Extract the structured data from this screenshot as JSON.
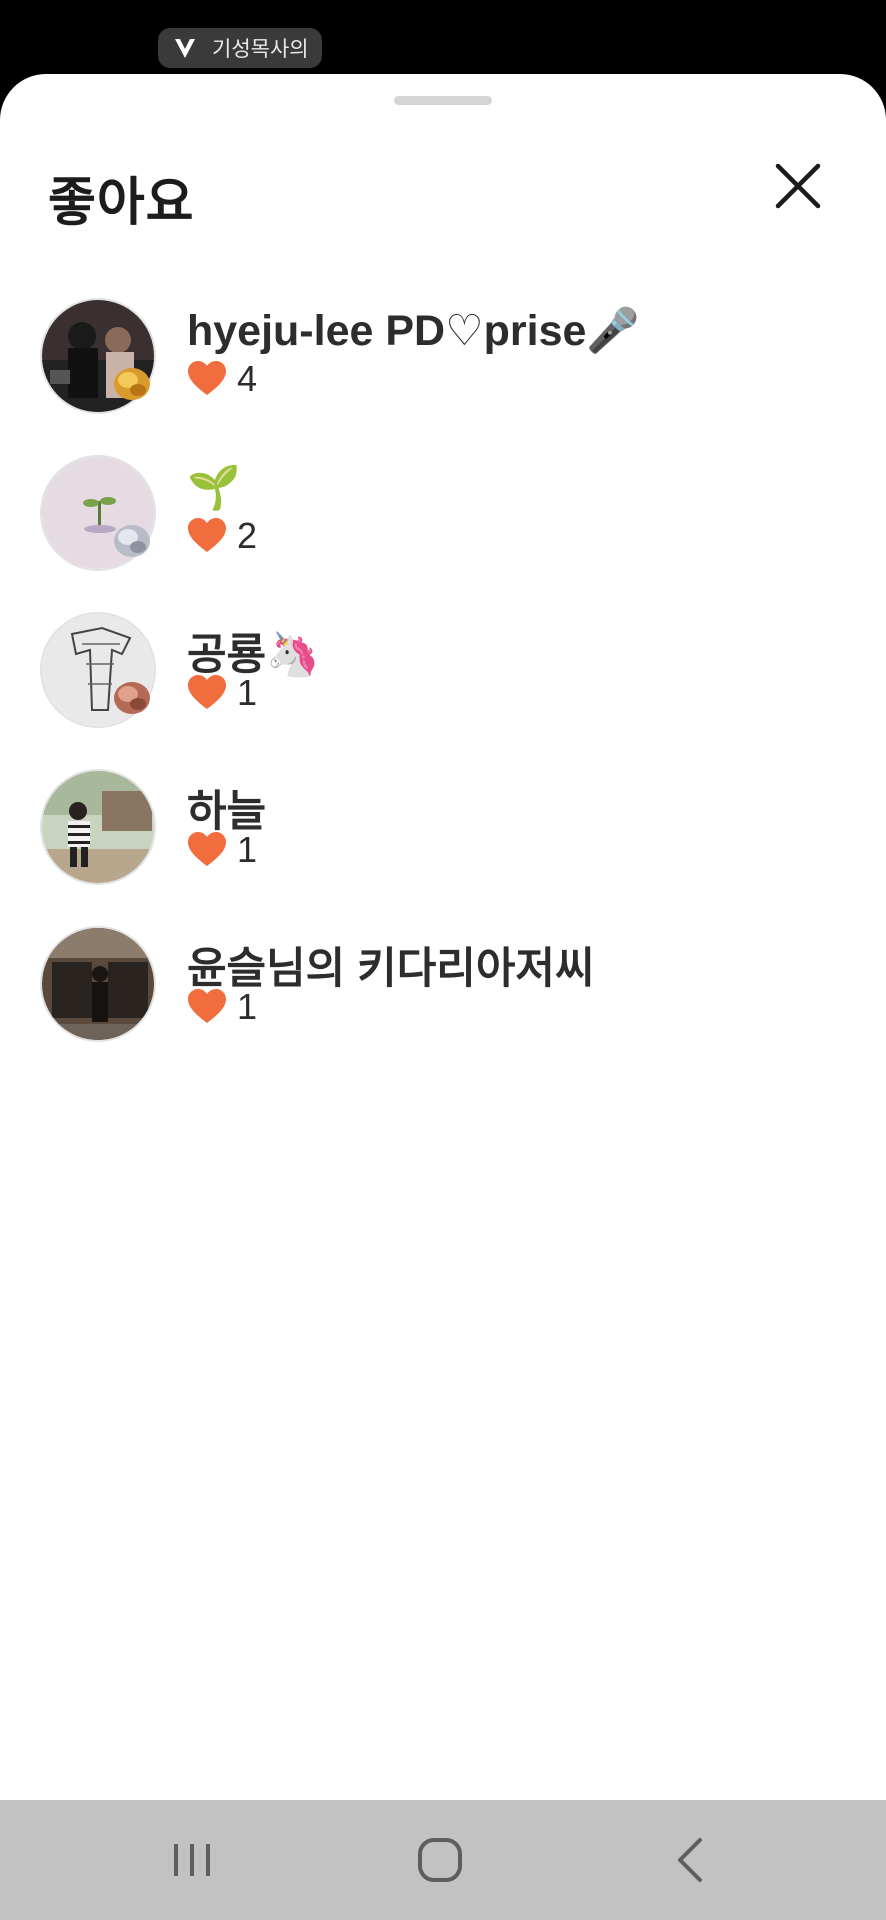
{
  "status_bar": {
    "notification_text": "기성목사의",
    "notification_icon": "v-logo-icon"
  },
  "sheet": {
    "title": "좋아요",
    "close_icon": "close-icon"
  },
  "likes": [
    {
      "name": "hyeju-lee PD♡prise🎤",
      "count": "4",
      "avatar": "photo-two-people",
      "badge": "gold-badge"
    },
    {
      "name": "🌱",
      "count": "2",
      "avatar": "photo-sprout",
      "badge": "silver-badge"
    },
    {
      "name": "공룡🦄",
      "count": "1",
      "avatar": "photo-sketch",
      "badge": "bronze-badge"
    },
    {
      "name": "하늘",
      "count": "1",
      "avatar": "photo-child-outdoors",
      "badge": ""
    },
    {
      "name": "윤슬님의 키다리아저씨",
      "count": "1",
      "avatar": "photo-storefront",
      "badge": ""
    }
  ],
  "heart_color": "#f26d3d",
  "nav_bar": {
    "recent_apps_icon": "recent-apps-icon",
    "home_icon": "home-icon",
    "back_icon": "back-icon"
  }
}
